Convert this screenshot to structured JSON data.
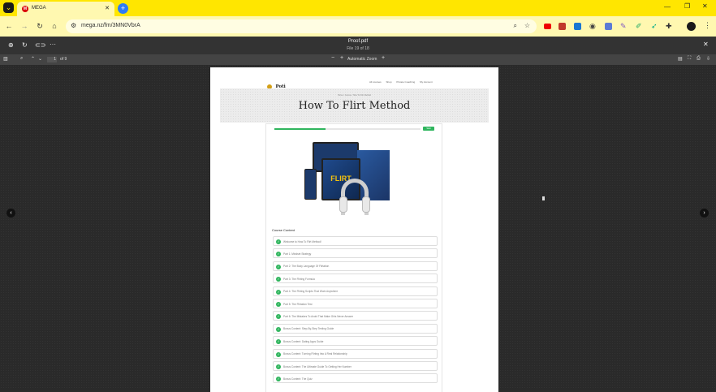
{
  "browser": {
    "tab_title": "MEGA",
    "tab_favicon": "M",
    "new_tab": "+",
    "url": "mega.nz/fm/3MN0VbrA",
    "accent": "#ffe600"
  },
  "viewer": {
    "file_name": "Proof.pdf",
    "file_counter": "File 19 of 18"
  },
  "pdf_toolbar": {
    "page_number": "1",
    "page_total": "of 9",
    "zoom": "Automatic Zoom"
  },
  "document": {
    "logo_text": "Poti",
    "nav": [
      "All courses",
      "Shop",
      "Private Coaching",
      "My Account"
    ],
    "title": "How To Flirt Method",
    "breadcrumb": "Home / Course / How To Flirt Method",
    "progress_label": "Start",
    "progress_fraction": 0.35,
    "product_word": "FLIRT",
    "section_heading": "Course Content",
    "lessons": [
      "Welcome to How To Flirt Method!",
      "Part 1: Mindset Strategy",
      "Part 2: The Body Language Of Flirtation",
      "Part 3: The Flirting Formula",
      "Part 4: The Flirting Scripts That Work Anywhere",
      "Part 5: The Flirtation Test",
      "Part 6: The Mistakes To Avoid That Make Girls Never Answer",
      "Bonus Content: Step-By-Step Texting Guide",
      "Bonus Content: Dating Apps Guide",
      "Bonus Content: Turning Flirting Into A Real Relationship",
      "Bonus Content: The Ultimate Guide To Getting Her Number",
      "Bonus Content: The Quiz"
    ],
    "colors": {
      "progress": "#2fb55d",
      "check": "#2fb55d"
    }
  }
}
